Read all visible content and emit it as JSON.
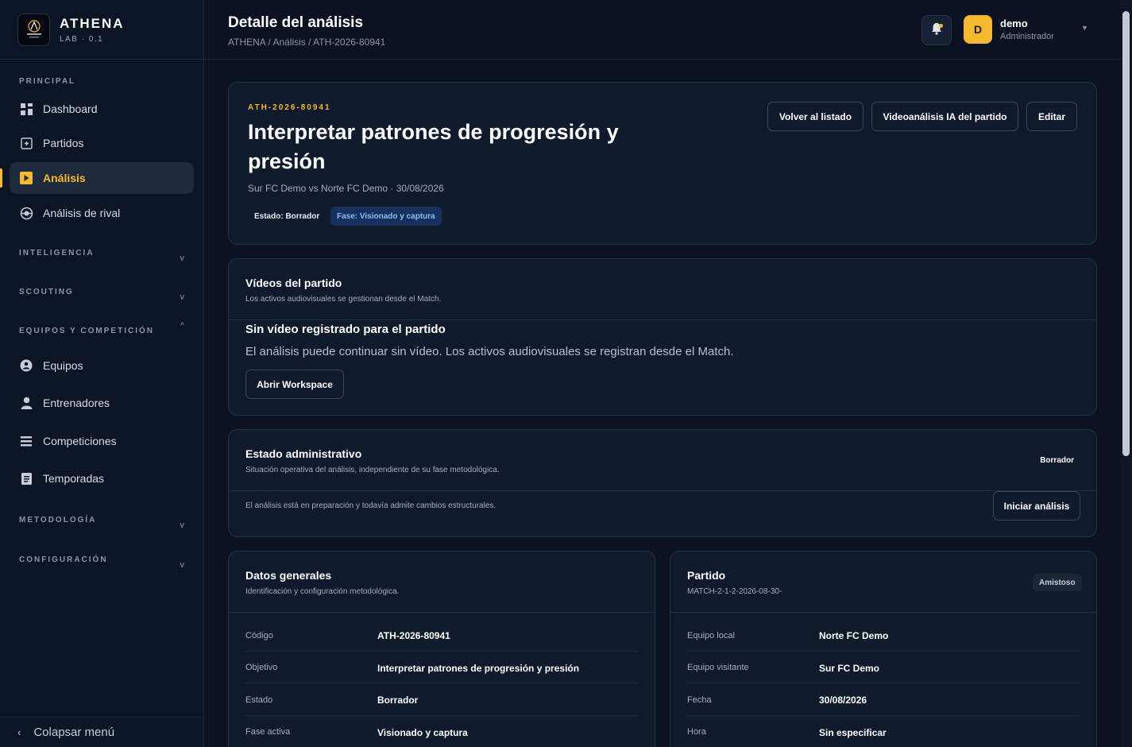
{
  "brand": {
    "name": "ATHENA",
    "sub": "LAB · 0.1"
  },
  "sidebar": {
    "principal_label": "PRINCIPAL",
    "items": [
      {
        "label": "Dashboard",
        "icon": "grid-icon"
      },
      {
        "label": "Partidos",
        "icon": "calendar-icon"
      },
      {
        "label": "Análisis",
        "icon": "play-icon",
        "active": true
      },
      {
        "label": "Análisis de rival",
        "icon": "target-icon"
      }
    ],
    "sections": {
      "inteligencia": "INTELIGENCIA",
      "scouting": "SCOUTING",
      "equipos": "EQUIPOS Y COMPETICIÓN",
      "metodologia": "METODOLOGÍA",
      "configuracion": "CONFIGURACIÓN"
    },
    "equipos_items": [
      {
        "label": "Equipos",
        "icon": "shield-icon"
      },
      {
        "label": "Entrenadores",
        "icon": "user-icon"
      },
      {
        "label": "Competiciones",
        "icon": "list-icon"
      },
      {
        "label": "Temporadas",
        "icon": "document-icon"
      }
    ],
    "chevrons": {
      "down": "v",
      "up": "^"
    },
    "collapse_label": "Colapsar menú"
  },
  "header": {
    "title": "Detalle del análisis",
    "breadcrumb": "ATHENA  /  Análisis / ATH-2026-80941",
    "user": {
      "initial": "D",
      "name": "demo",
      "role": "Administrador"
    }
  },
  "analysis": {
    "code": "ATH-2026-80941",
    "title": "Interpretar patrones de progresión y presión",
    "meta": "Sur FC Demo vs Norte FC Demo · 30/08/2026",
    "state_pill": "Estado: Borrador",
    "phase_pill": "Fase: Visionado y captura",
    "buttons": {
      "back": "Volver al listado",
      "video_ai": "Videoanálisis IA del partido",
      "edit": "Editar"
    }
  },
  "videos": {
    "title": "Vídeos del partido",
    "subtitle": "Los activos audiovisuales se gestionan desde el Match.",
    "empty_title": "Sin vídeo registrado para el partido",
    "empty_text": "El análisis puede continuar sin vídeo. Los activos audiovisuales se registran desde el Match.",
    "button": "Abrir Workspace"
  },
  "admin": {
    "title": "Estado administrativo",
    "subtitle": "Situación operativa del análisis, independiente de su fase metodológica.",
    "status": "Borrador",
    "note": "El análisis está en preparación y todavía admite cambios estructurales.",
    "button": "Iniciar análisis"
  },
  "general": {
    "title": "Datos generales",
    "subtitle": "Identificación y configuración metodológica.",
    "rows": [
      {
        "label": "Código",
        "value": "ATH-2026-80941"
      },
      {
        "label": "Objetivo",
        "value": "Interpretar patrones de progresión y presión"
      },
      {
        "label": "Estado",
        "value": "Borrador"
      },
      {
        "label": "Fase activa",
        "value": "Visionado y captura"
      }
    ]
  },
  "match": {
    "title": "Partido",
    "subtitle": "MATCH-2-1-2-2026-08-30-",
    "tag": "Amistoso",
    "rows": [
      {
        "label": "Equipo local",
        "value": "Norte FC Demo"
      },
      {
        "label": "Equipo visitante",
        "value": "Sur FC Demo"
      },
      {
        "label": "Fecha",
        "value": "30/08/2026"
      },
      {
        "label": "Hora",
        "value": "Sin especificar"
      }
    ]
  }
}
